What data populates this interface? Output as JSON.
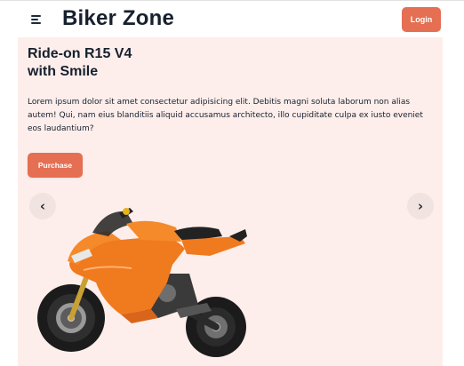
{
  "header": {
    "menu_icon": "hamburger-menu-icon",
    "brand": "Biker Zone",
    "login_label": "Login"
  },
  "hero": {
    "title_line1": "Ride-on R15 V4",
    "title_line2": "with Smile",
    "description": "Lorem ipsum dolor sit amet consectetur adipisicing elit. Debitis magni soluta laborum non alias autem! Qui, nam eius blanditiis aliquid accusamus architecto, illo cupiditate culpa ex iusto eveniet eos laudantium?",
    "purchase_label": "Purchase",
    "prev_icon": "‹",
    "next_icon": "›",
    "image": "motorcycle-image"
  },
  "colors": {
    "accent": "#e46f52",
    "hero_bg": "#fdeeeb",
    "text": "#16202e",
    "bike_orange": "#f07a1e"
  }
}
